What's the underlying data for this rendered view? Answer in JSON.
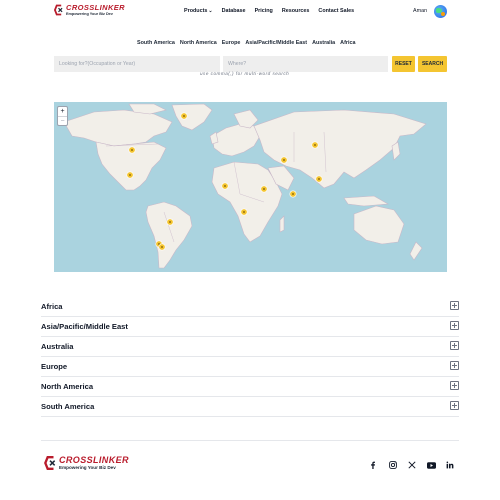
{
  "brand": {
    "name": "CROSSLINKER",
    "tagline": "Empowering Your Biz Dev",
    "primary_color": "#b91c2c",
    "accent_color": "#f4c531"
  },
  "nav": {
    "items": [
      {
        "label": "Products",
        "has_dropdown": true
      },
      {
        "label": "Database"
      },
      {
        "label": "Pricing"
      },
      {
        "label": "Resources"
      },
      {
        "label": "Contact Sales"
      }
    ]
  },
  "user": {
    "name": "Aman",
    "avatar_icon": "globe-icon"
  },
  "region_tabs": [
    "South America",
    "North America",
    "Europe",
    "Asia/Pacific/Middle East",
    "Australia",
    "Africa"
  ],
  "search": {
    "occupation_placeholder": "Looking for?(Occupation or Year)",
    "occupation_value": "",
    "where_placeholder": "Where?",
    "where_value": "",
    "reset_label": "RESET",
    "search_label": "SEARCH",
    "hint": "use comma(,) for multi-word search"
  },
  "map": {
    "zoom_in": "+",
    "zoom_out": "−",
    "marker_color": "#f4c531",
    "markers": [
      "Greenland",
      "Western Canada",
      "United States",
      "Central Asia",
      "Central China",
      "East Asia",
      "North Africa",
      "Middle East",
      "India",
      "Central Africa",
      "Brazil",
      "Paraguay",
      "Argentina"
    ]
  },
  "accordion": [
    "Africa",
    "Asia/Pacific/Middle East",
    "Australia",
    "Europe",
    "North America",
    "South America"
  ],
  "footer": {
    "social": [
      {
        "name": "facebook",
        "glyph": "f"
      },
      {
        "name": "instagram",
        "glyph": "◎"
      },
      {
        "name": "x",
        "glyph": "𝕏"
      },
      {
        "name": "youtube",
        "glyph": "▶"
      },
      {
        "name": "linkedin",
        "glyph": "in"
      }
    ]
  }
}
